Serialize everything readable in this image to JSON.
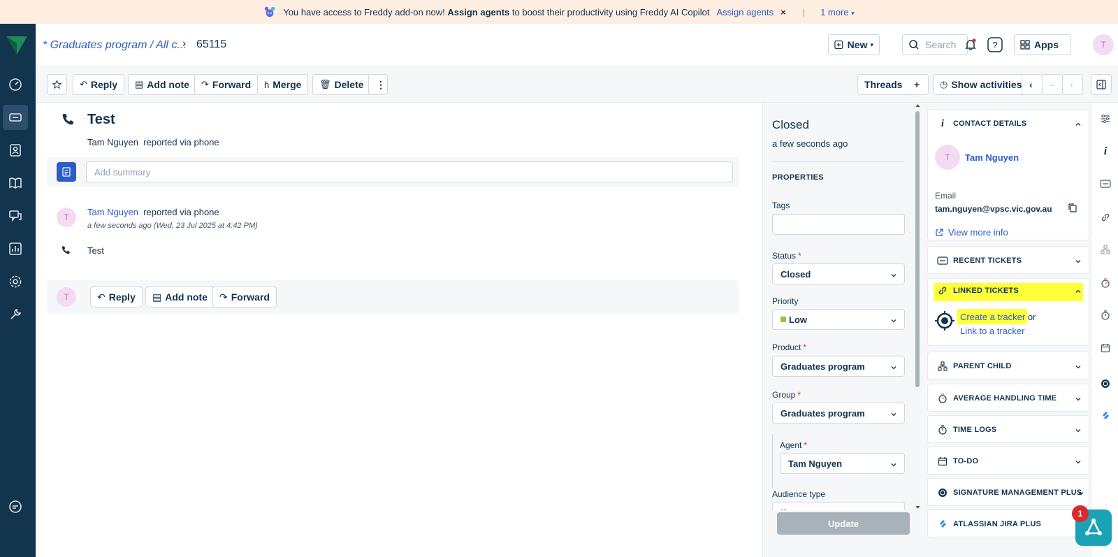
{
  "banner": {
    "text_prefix": "You have access to Freddy add-on now!",
    "text_bold": "Assign agents",
    "text_suffix": "to boost their productivity using Freddy AI Copilot",
    "link": "Assign agents",
    "close": "×",
    "separator": "|",
    "more": "1 more"
  },
  "header": {
    "breadcrumb": "* Graduates program / All c...",
    "breadcrumb_sep": "›",
    "ticket_id": "65115",
    "new_label": "New",
    "search_placeholder": "Search",
    "apps_label": "Apps",
    "avatar": "T"
  },
  "toolbar": {
    "reply": "Reply",
    "add_note": "Add note",
    "forward": "Forward",
    "merge": "Merge",
    "delete": "Delete",
    "more": "⋮",
    "threads": "Threads",
    "add": "+",
    "show_activities": "Show activities"
  },
  "ticket": {
    "title": "Test",
    "requester": "Tam Nguyen",
    "via": "reported via phone",
    "summary_placeholder": "Add summary",
    "conversation": {
      "avatar": "T",
      "name": "Tam Nguyen",
      "via": "reported via phone",
      "time": "a few seconds ago (Wed, 23 Jul 2025 at 4:42 PM)",
      "body": "Test"
    },
    "reply_bar": {
      "avatar": "T",
      "reply": "Reply",
      "add_note": "Add note",
      "forward": "Forward"
    }
  },
  "properties": {
    "status_title": "Closed",
    "status_time": "a few seconds ago",
    "section_title": "PROPERTIES",
    "tags_label": "Tags",
    "tags_value": "",
    "status_label": "Status",
    "status_value": "Closed",
    "priority_label": "Priority",
    "priority_value": "Low",
    "priority_color": "#8dc63f",
    "product_label": "Product",
    "product_value": "Graduates program",
    "group_label": "Group",
    "group_value": "Graduates program",
    "agent_label": "Agent",
    "agent_value": "Tam Nguyen",
    "audience_label": "Audience type",
    "audience_value": "--",
    "required_mark": "*",
    "update": "Update"
  },
  "widgets": {
    "contact": {
      "title": "CONTACT DETAILS",
      "avatar": "T",
      "name": "Tam Nguyen",
      "email_label": "Email",
      "email": "tam.nguyen@vpsc.vic.gov.au",
      "view_more": "View more info"
    },
    "recent": "RECENT TICKETS",
    "linked": {
      "title": "LINKED TICKETS",
      "create": "Create a tracker",
      "or": "or",
      "link": "Link to a tracker"
    },
    "parent_child": "PARENT CHILD",
    "aht": "AVERAGE HANDLING TIME",
    "time_logs": "TIME LOGS",
    "todo": "TO-DO",
    "signature": "SIGNATURE MANAGEMENT PLUS",
    "jira": "ATLASSIAN JIRA PLUS"
  },
  "fab": {
    "badge": "1"
  },
  "colors": {
    "nav_bg": "#12344d",
    "link": "#2c5cc5",
    "highlight": "#ffff3a",
    "banner_bg": "#fdeee1"
  }
}
